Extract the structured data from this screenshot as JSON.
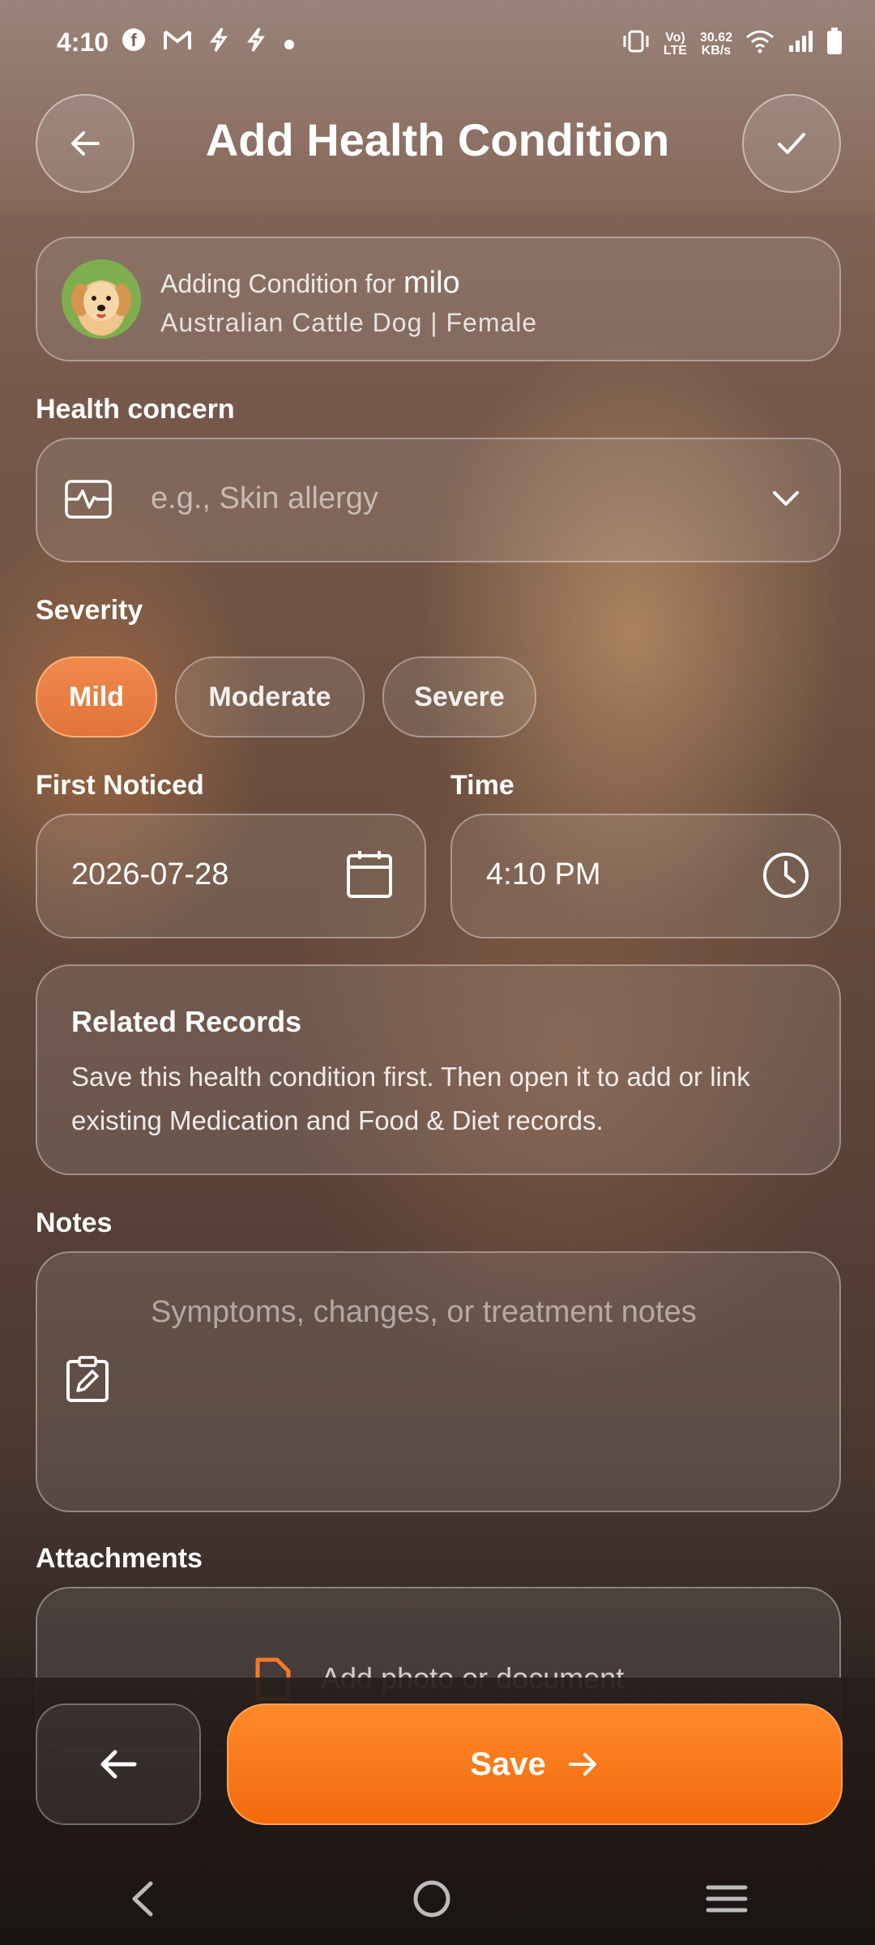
{
  "status_bar": {
    "time": "4:10",
    "net_speed_value": "30.62",
    "net_speed_unit": "KB/s",
    "lte_top": "Vo)",
    "lte_bottom": "LTE"
  },
  "header": {
    "title": "Add Health Condition"
  },
  "pet": {
    "prefix": "Adding Condition for",
    "name": "milo",
    "details": "Australian Cattle Dog | Female"
  },
  "health_concern": {
    "label": "Health concern",
    "placeholder": "e.g., Skin allergy"
  },
  "severity": {
    "label": "Severity",
    "options": [
      "Mild",
      "Moderate",
      "Severe"
    ],
    "selected": "Mild"
  },
  "first_noticed": {
    "label": "First Noticed",
    "value": "2026-07-28"
  },
  "time": {
    "label": "Time",
    "value": "4:10 PM"
  },
  "related_records": {
    "title": "Related Records",
    "text": "Save this health condition first. Then open it to add or link existing Medication and Food & Diet records."
  },
  "notes": {
    "label": "Notes",
    "placeholder": "Symptoms, changes, or treatment notes"
  },
  "attachments": {
    "label": "Attachments",
    "add_text": "Add photo or document"
  },
  "footer": {
    "save_label": "Save"
  },
  "colors": {
    "accent": "#f26a0c",
    "chip_selected": "#e2733a"
  }
}
